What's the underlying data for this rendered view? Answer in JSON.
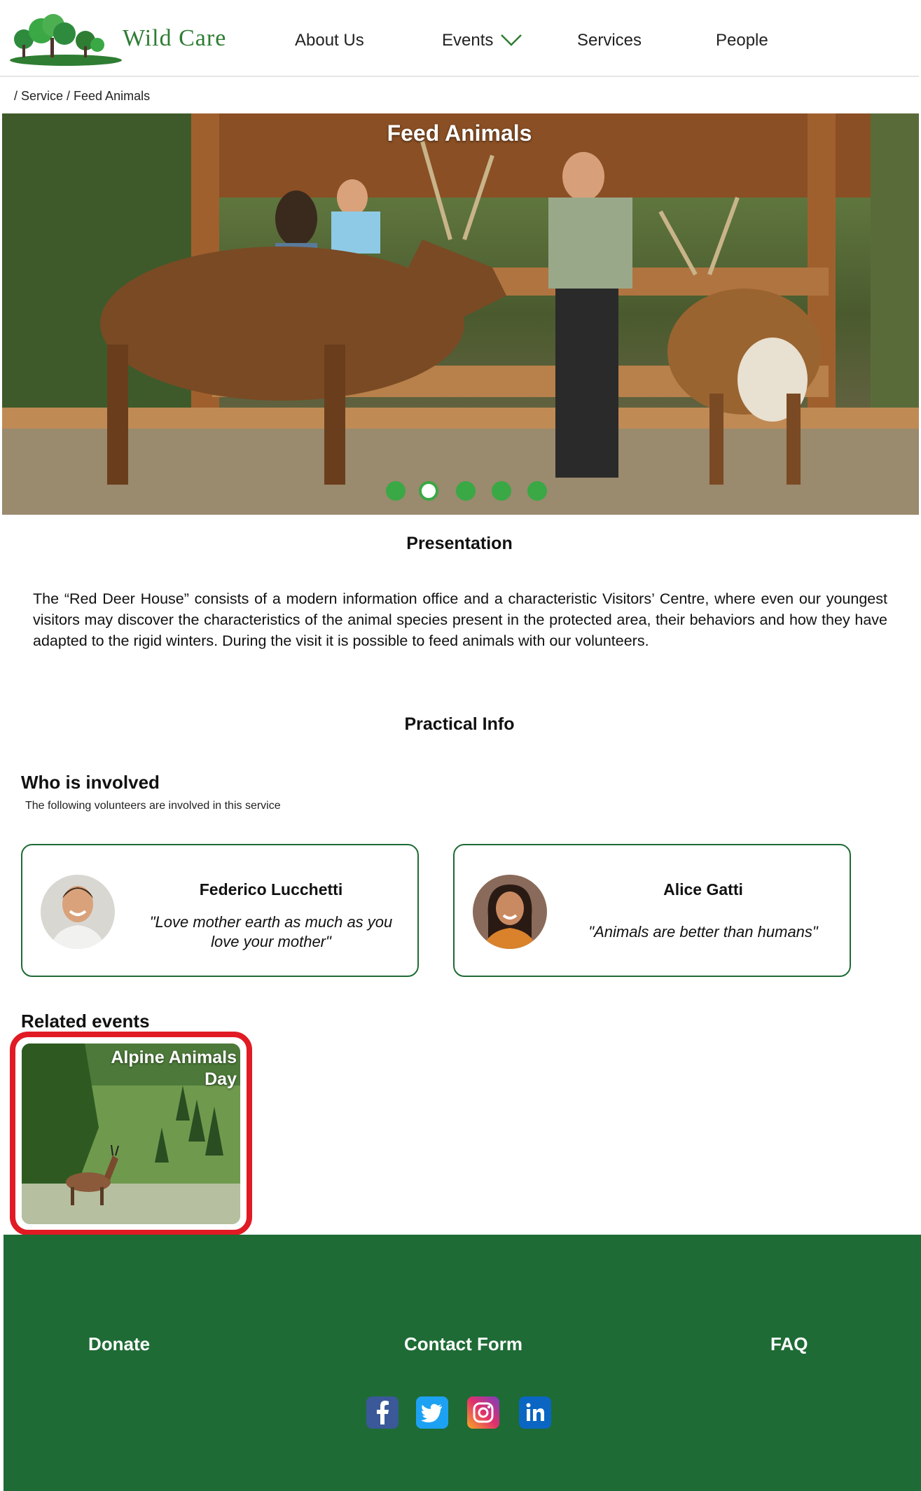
{
  "brand": {
    "name": "Wild Care",
    "primary_color": "#1e6b35",
    "accent_color": "#3aa845",
    "highlight_color": "#e01b24"
  },
  "nav": {
    "about": "About Us",
    "events": "Events",
    "services": "Services",
    "people": "People"
  },
  "breadcrumb": "/ Service / Feed Animals",
  "hero": {
    "title": "Feed Animals",
    "slides": 5,
    "active_slide": 2
  },
  "presentation": {
    "title": "Presentation",
    "text": "The “Red Deer House” consists of a modern information office and a characteristic Visitors’ Centre, where even our youngest visitors may discover the characteristics of the animal species present in the protected area, their behaviors and how they have adapted to the rigid winters. During the visit it is possible to feed animals with our volunteers."
  },
  "practical_info": {
    "title": "Practical Info"
  },
  "who": {
    "title": "Who is involved",
    "subtitle": "The following volunteers are involved in this service",
    "volunteers": [
      {
        "name": "Federico Lucchetti",
        "quote": "\"Love mother earth as much as you love your mother\""
      },
      {
        "name": "Alice Gatti",
        "quote": "\"Animals are better than humans\""
      }
    ]
  },
  "related": {
    "title": "Related events",
    "events": [
      {
        "title": "Alpine Animals Day"
      }
    ]
  },
  "footer": {
    "donate": "Donate",
    "contact": "Contact Form",
    "faq": "FAQ",
    "social": [
      "facebook-icon",
      "twitter-icon",
      "instagram-icon",
      "linkedin-icon"
    ]
  }
}
